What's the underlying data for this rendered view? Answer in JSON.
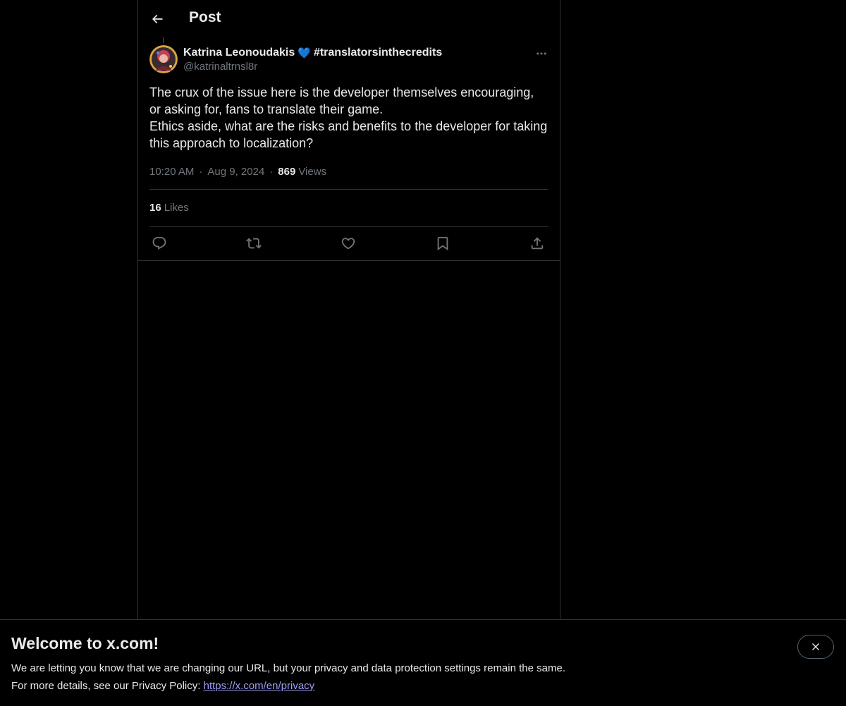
{
  "header": {
    "title": "Post"
  },
  "author": {
    "name": "Katrina Leonoudakis",
    "heart": "💙",
    "hashtag": "#translatorsinthecredits",
    "handle": "@katrinaltrnsl8r"
  },
  "tweet": {
    "line1": "The crux of the issue here is the developer themselves encouraging, or asking for, fans to translate their game.",
    "line2": "Ethics aside, what are the risks and benefits to the developer for taking this approach to localization?"
  },
  "meta": {
    "time": "10:20 AM",
    "separator": "·",
    "date": "Aug 9, 2024",
    "views_count": "869",
    "views_label": "Views"
  },
  "likes": {
    "count": "16",
    "label": "Likes"
  },
  "actions": [
    "reply-icon",
    "repost-icon",
    "like-icon",
    "bookmark-icon",
    "share-icon"
  ],
  "banner": {
    "title": "Welcome to x.com!",
    "line1": "We are letting you know that we are changing our URL, but your privacy and data protection settings remain the same.",
    "line2_prefix": "For more details, see our Privacy Policy:",
    "link": "https://x.com/en/privacy"
  },
  "colors": {
    "background": "#000000",
    "text": "#e7e9ea",
    "muted": "#71767b",
    "border": "#2f3336",
    "link": "#9d9df5"
  }
}
